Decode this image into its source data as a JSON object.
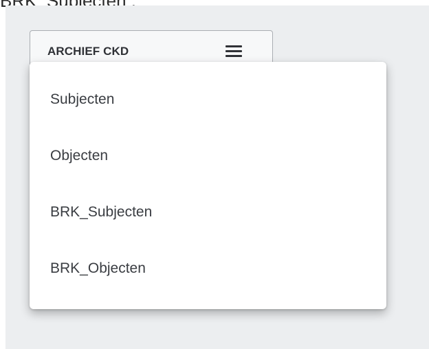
{
  "header": {
    "partial_text": "BRK_Subjecten :"
  },
  "toolbar": {
    "archive_label": "ARCHIEF CKD",
    "menu_icon": "hamburger-icon"
  },
  "menu": {
    "items": [
      {
        "label": "Subjecten"
      },
      {
        "label": "Objecten"
      },
      {
        "label": "BRK_Subjecten"
      },
      {
        "label": "BRK_Objecten"
      }
    ]
  },
  "colors": {
    "panel_background": "#eceef0",
    "menu_background": "#ffffff",
    "text": "#3a3d42"
  }
}
